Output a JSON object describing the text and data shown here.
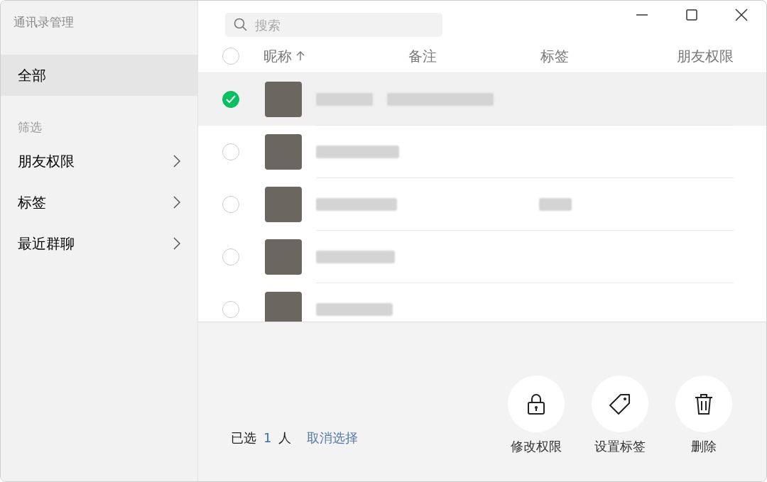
{
  "sidebar": {
    "title": "通讯录管理",
    "items": [
      {
        "label": "全部",
        "selected": true
      }
    ],
    "filter_heading": "筛选",
    "filters": [
      {
        "label": "朋友权限"
      },
      {
        "label": "标签"
      },
      {
        "label": "最近群聊"
      }
    ]
  },
  "search": {
    "placeholder": "搜索"
  },
  "table": {
    "select_all": {
      "checked": false
    },
    "columns": [
      {
        "label": "昵称",
        "sorted": true
      },
      {
        "label": "备注"
      },
      {
        "label": "标签"
      },
      {
        "label": "朋友权限"
      }
    ],
    "rows": [
      {
        "selected": true,
        "remark_redacted": true,
        "tag_redacted": false
      },
      {
        "selected": false,
        "remark_redacted": false,
        "tag_redacted": false
      },
      {
        "selected": false,
        "remark_redacted": false,
        "tag_redacted": true
      },
      {
        "selected": false,
        "remark_redacted": false,
        "tag_redacted": false
      },
      {
        "selected": false,
        "remark_redacted": false,
        "tag_redacted": false
      }
    ]
  },
  "footer": {
    "selected_prefix": "已选",
    "selected_count": "1",
    "selected_suffix": "人",
    "clear_link": "取消选择",
    "actions": [
      {
        "kind": "lock",
        "label": "修改权限"
      },
      {
        "kind": "tag",
        "label": "设置标签"
      },
      {
        "kind": "trash",
        "label": "删除"
      }
    ]
  }
}
